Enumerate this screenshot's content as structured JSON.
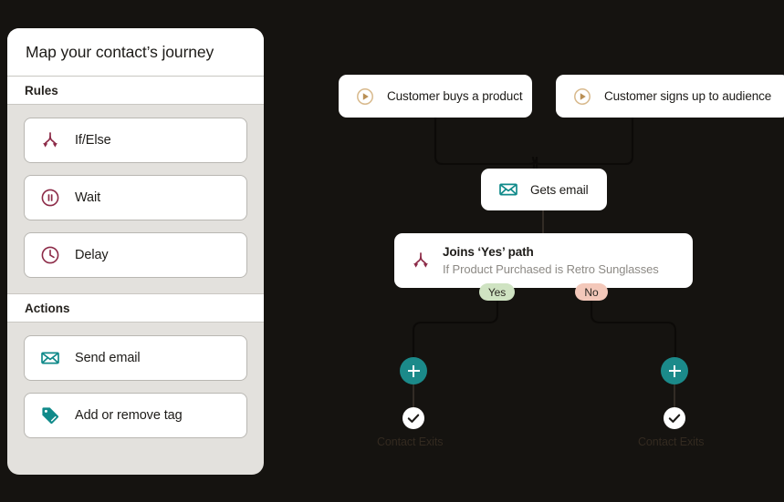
{
  "theme": {
    "canvas_bg": "#151310",
    "panel_bg": "#e3e1dd",
    "card_bg": "#ffffff",
    "accent_teal": "#1b8a8a",
    "accent_maroon": "#8c2a47",
    "accent_tan": "#d8b98c",
    "yes_pill_bg": "#cfe3c2",
    "no_pill_bg": "#f3c8ba",
    "exit_label_color": "#332a20"
  },
  "sidebar": {
    "title": "Map your contact’s journey",
    "sections": [
      {
        "header": "Rules",
        "items": [
          {
            "label": "If/Else",
            "icon": "branch-icon",
            "icon_color": "#8c2a47"
          },
          {
            "label": "Wait",
            "icon": "pause-circle-icon",
            "icon_color": "#8c2a47"
          },
          {
            "label": "Delay",
            "icon": "clock-icon",
            "icon_color": "#8c2a47"
          }
        ]
      },
      {
        "header": "Actions",
        "items": [
          {
            "label": "Send email",
            "icon": "envelope-icon",
            "icon_color": "#108a8a"
          },
          {
            "label": "Add or remove tag",
            "icon": "tag-icon",
            "icon_color": "#108a8a"
          }
        ]
      }
    ]
  },
  "flow": {
    "triggers": [
      {
        "label": "Customer buys a product",
        "icon": "play-circle-icon"
      },
      {
        "label": "Customer signs up to audience",
        "icon": "play-circle-icon"
      }
    ],
    "email_node": {
      "label": "Gets email",
      "icon": "envelope-icon"
    },
    "condition_node": {
      "title": "Joins ‘Yes’ path",
      "subtitle": "If Product Purchased is Retro Sunglasses",
      "icon": "branch-icon"
    },
    "branches": [
      {
        "pill": "Yes",
        "add_label": "+",
        "exit_label": "Contact Exits"
      },
      {
        "pill": "No",
        "add_label": "+",
        "exit_label": "Contact Exits"
      }
    ]
  }
}
